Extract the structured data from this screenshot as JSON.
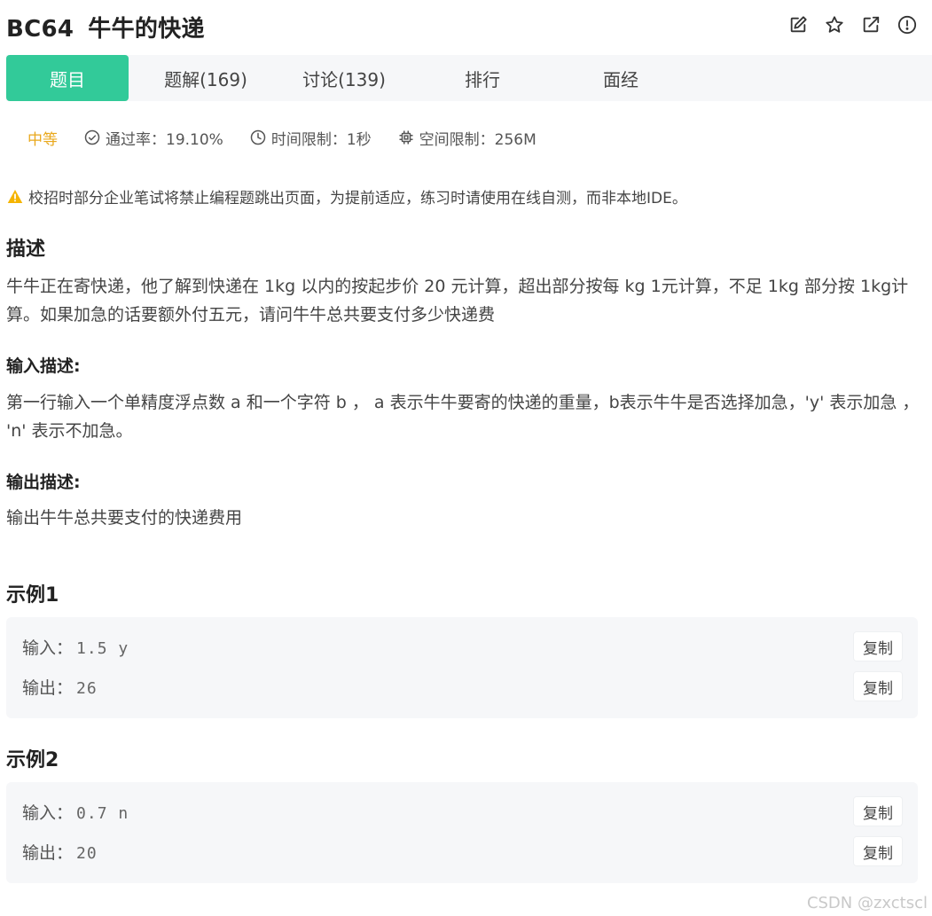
{
  "problem": {
    "code": "BC64",
    "title": "牛牛的快递"
  },
  "header_actions": [
    {
      "name": "edit-icon"
    },
    {
      "name": "star-icon"
    },
    {
      "name": "share-icon"
    },
    {
      "name": "report-icon"
    }
  ],
  "tabs": [
    {
      "label": "题目",
      "active": true
    },
    {
      "label": "题解(169)",
      "active": false
    },
    {
      "label": "讨论(139)",
      "active": false
    },
    {
      "label": "排行",
      "active": false
    },
    {
      "label": "面经",
      "active": false
    }
  ],
  "meta": {
    "difficulty": "中等",
    "pass_rate": "通过率：19.10%",
    "time_limit": "时间限制：1秒",
    "space_limit": "空间限制：256M"
  },
  "warning": "校招时部分企业笔试将禁止编程题跳出页面，为提前适应，练习时请使用在线自测，而非本地IDE。",
  "description": {
    "heading": "描述",
    "text": "牛牛正在寄快递，他了解到快递在 1kg 以内的按起步价 20 元计算，超出部分按每 kg 1元计算，不足 1kg 部分按 1kg计算。如果加急的话要额外付五元，请问牛牛总共要支付多少快递费"
  },
  "input_desc": {
    "heading": "输入描述:",
    "text": "第一行输入一个单精度浮点数 a 和一个字符 b ， a 表示牛牛要寄的快递的重量，b表示牛牛是否选择加急，'y' 表示加急 ， 'n' 表示不加急。"
  },
  "output_desc": {
    "heading": "输出描述:",
    "text": "输出牛牛总共要支付的快递费用"
  },
  "examples": [
    {
      "heading": "示例1",
      "input_label": "输入：",
      "input_value": "1.5 y",
      "output_label": "输出：",
      "output_value": "26",
      "copy_label": "复制"
    },
    {
      "heading": "示例2",
      "input_label": "输入：",
      "input_value": "0.7 n",
      "output_label": "输出：",
      "output_value": "20",
      "copy_label": "复制"
    }
  ],
  "watermark": "CSDN @zxctscl",
  "colors": {
    "accent": "#32ca99",
    "difficulty": "#e9a81c",
    "warning": "#f5b400"
  }
}
